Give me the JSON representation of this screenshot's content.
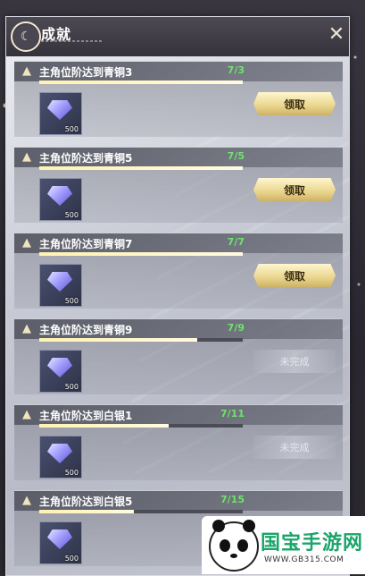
{
  "header": {
    "title": "成就",
    "emblem_icon": "crescent-moon-icon",
    "close_icon": "close-x-icon"
  },
  "achievements": [
    {
      "title": "主角位阶达到青铜3",
      "progress_text": "7/3",
      "progress": 1.0,
      "reward_qty": "500",
      "status": "claimable",
      "button_label": "领取"
    },
    {
      "title": "主角位阶达到青铜5",
      "progress_text": "7/5",
      "progress": 1.0,
      "reward_qty": "500",
      "status": "claimable",
      "button_label": "领取"
    },
    {
      "title": "主角位阶达到青铜7",
      "progress_text": "7/7",
      "progress": 1.0,
      "reward_qty": "500",
      "status": "claimable",
      "button_label": "领取"
    },
    {
      "title": "主角位阶达到青铜9",
      "progress_text": "7/9",
      "progress": 0.778,
      "reward_qty": "500",
      "status": "incomplete",
      "button_label": "未完成"
    },
    {
      "title": "主角位阶达到白银1",
      "progress_text": "7/11",
      "progress": 0.636,
      "reward_qty": "500",
      "status": "incomplete",
      "button_label": "未完成"
    },
    {
      "title": "主角位阶达到白银5",
      "progress_text": "7/15",
      "progress": 0.467,
      "reward_qty": "500",
      "status": "incomplete",
      "button_label": ""
    }
  ],
  "watermark": {
    "title": "国宝手游网",
    "url": "WWW.GB315.COM"
  },
  "colors": {
    "progress_text": "#6fe36d",
    "claim_button": "#e9d58c",
    "bar_fill": "#fff3b0"
  }
}
